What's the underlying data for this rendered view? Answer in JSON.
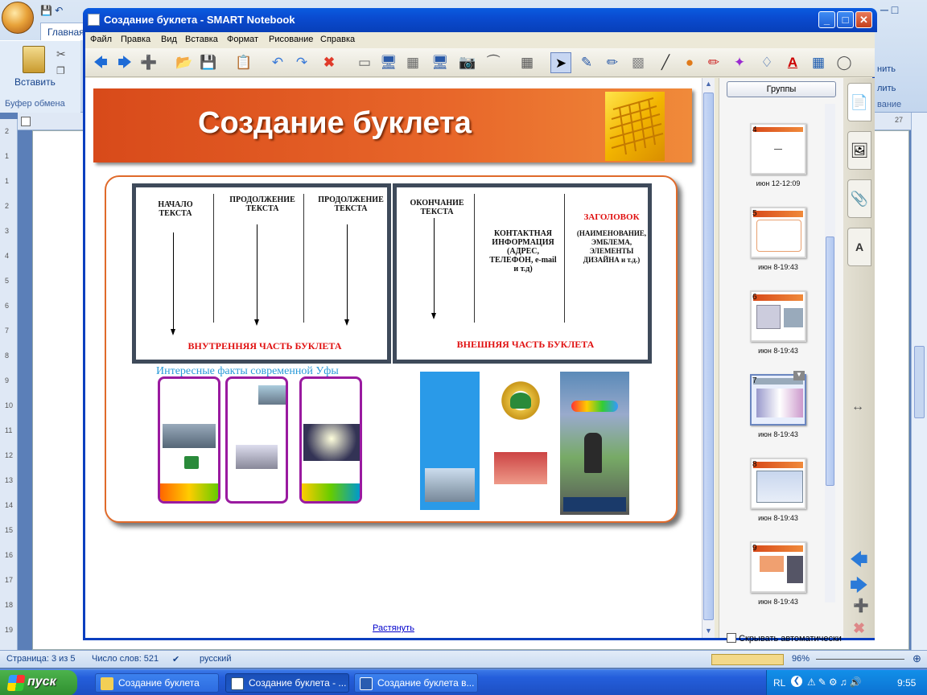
{
  "word": {
    "tab_home": "Главная",
    "paste_label": "Вставить",
    "clipboard_group": "Буфер обмена",
    "right_frag1": "нить",
    "right_frag2": "лить",
    "right_frag3": "вание",
    "status": {
      "page": "Страница: 3 из 5",
      "words": "Число слов: 521",
      "language": "русский",
      "zoom": "96%"
    },
    "ruler_marks": [
      "2",
      "1",
      "1",
      "2",
      "3",
      "4",
      "5",
      "6",
      "7",
      "8",
      "9",
      "10",
      "11",
      "12",
      "13",
      "14",
      "15",
      "16",
      "17",
      "18",
      "19"
    ],
    "ruler_top_right": "27"
  },
  "taskbar": {
    "start": "пуск",
    "tasks": [
      {
        "label": "Создание буклета",
        "active": false
      },
      {
        "label": "Создание буклета - ...",
        "active": true
      },
      {
        "label": "Создание буклета в...",
        "active": false
      }
    ],
    "lang": "RL",
    "time": "9:55"
  },
  "smart": {
    "title": "Создание буклета - SMART Notebook",
    "menu": [
      "Файл",
      "Правка",
      "Вид",
      "Вставка",
      "Формат",
      "Рисование",
      "Справка"
    ],
    "tools": [
      "back-icon",
      "forward-icon",
      "add-page-icon",
      "open-icon",
      "save-icon",
      "paste-icon",
      "undo-icon",
      "redo-icon",
      "delete-icon",
      "screen-shade-icon",
      "full-screen-icon",
      "transparent-bg-icon",
      "show-display-icon",
      "capture-icon",
      "document-camera-icon",
      "table-icon",
      "select-icon",
      "pen-icon",
      "creative-pen-icon",
      "eraser-icon",
      "line-icon",
      "shape-icon",
      "fill-pen-icon",
      "magic-pen-icon",
      "fill-icon",
      "text-icon",
      "properties-icon",
      "font-icon"
    ],
    "slide": {
      "banner_title": "Создание буклета",
      "inner": {
        "col1": "НАЧАЛО ТЕКСТА",
        "col2": "ПРОДОЛЖЕНИЕ ТЕКСТА",
        "col3": "ПРОДОЛЖЕНИЕ ТЕКСТА",
        "caption": "ВНУТРЕННЯЯ ЧАСТЬ БУКЛЕТА"
      },
      "outer": {
        "col1": "ОКОНЧАНИЕ ТЕКСТА",
        "col2": "КОНТАКТНАЯ ИНФОРМАЦИЯ (АДРЕС, ТЕЛЕФОН, e-mail и т.д)",
        "col3_title": "ЗАГОЛОВОК",
        "col3_sub": "(НАИМЕНОВАНИЕ, ЭМБЛЕМА, ЭЛЕМЕНТЫ ДИЗАЙНА и т.д.)",
        "caption": "ВНЕШНЯЯ  ЧАСТЬ БУКЛЕТА"
      },
      "example_title": "Интересные факты современной Уфы",
      "link": "Растянуть"
    },
    "sidebar": {
      "groups_btn": "Группы",
      "hide_auto": "Скрывать автоматически",
      "pages": [
        {
          "num": "4",
          "time": "июн 12-12:09"
        },
        {
          "num": "5",
          "time": "июн 8-19:43"
        },
        {
          "num": "6",
          "time": "июн 8-19:43"
        },
        {
          "num": "7",
          "time": "июн 8-19:43"
        },
        {
          "num": "8",
          "time": "июн 8-19:43"
        },
        {
          "num": "9",
          "time": "июн 8-19:43"
        }
      ]
    }
  },
  "colors": {
    "accent": "#e8672a",
    "title_bar": "#0a4bd0",
    "red_caption": "#e01010",
    "brochure_border": "#9a1aa0"
  }
}
